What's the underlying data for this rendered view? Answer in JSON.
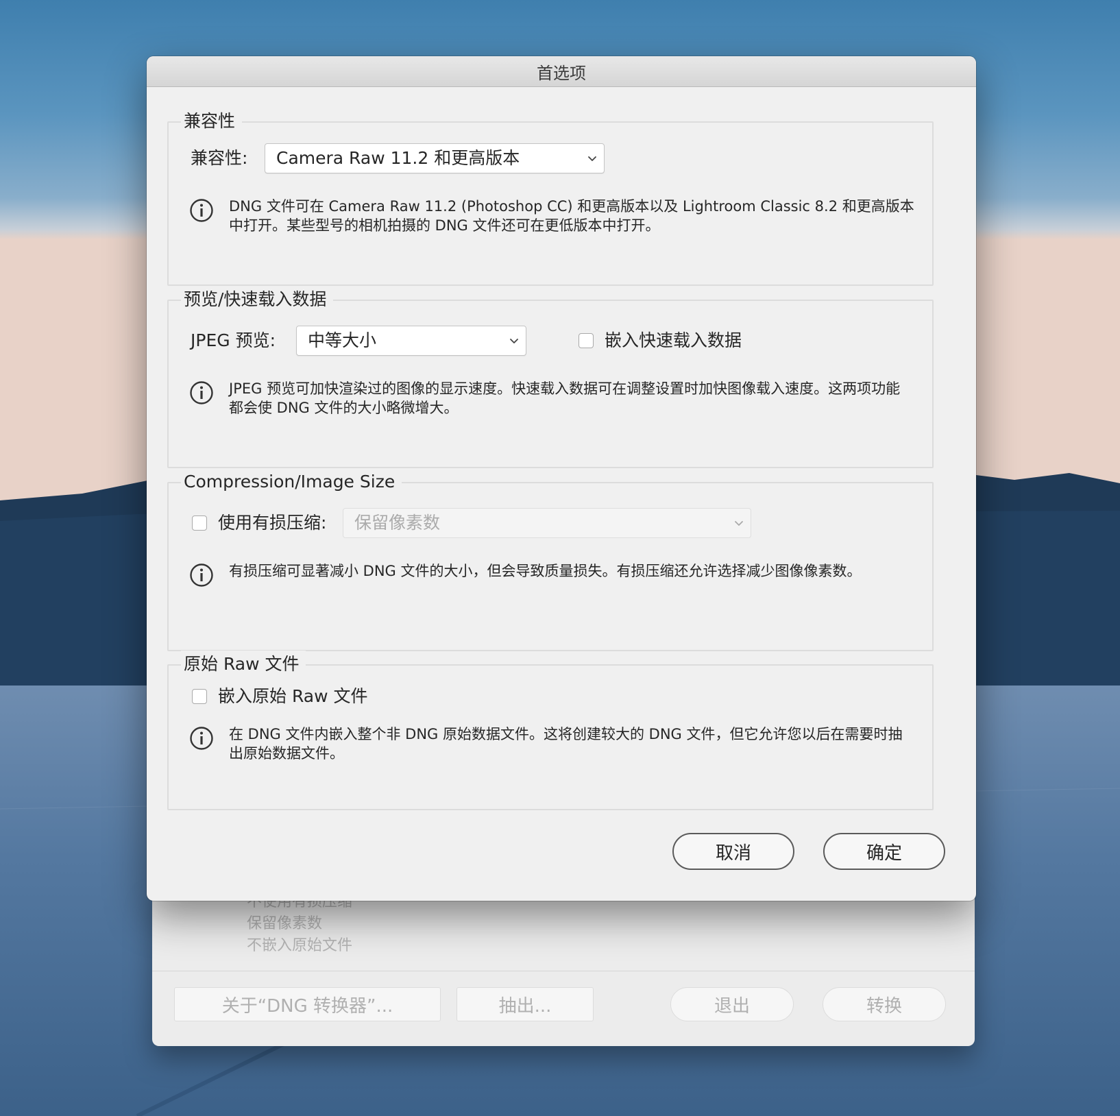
{
  "background_window": {
    "summary_lines": [
      "不使用有损压缩",
      "保留像素数",
      "不嵌入原始文件"
    ],
    "buttons": {
      "about": "关于“DNG 转换器”...",
      "extract": "抽出...",
      "quit": "退出",
      "convert": "转换"
    }
  },
  "dialog": {
    "title": "首选项",
    "compatibility": {
      "group_title": "兼容性",
      "label": "兼容性:",
      "selected": "Camera Raw 11.2 和更高版本",
      "info": "DNG 文件可在 Camera Raw 11.2 (Photoshop CC) 和更高版本以及 Lightroom Classic 8.2 和更高版本中打开。某些型号的相机拍摄的 DNG 文件还可在更低版本中打开。"
    },
    "preview": {
      "group_title": "预览/快速载入数据",
      "jpeg_label": "JPEG 预览:",
      "jpeg_selected": "中等大小",
      "fast_load_label": "嵌入快速载入数据",
      "fast_load_checked": false,
      "info": "JPEG 预览可加快渲染过的图像的显示速度。快速载入数据可在调整设置时加快图像载入速度。这两项功能都会使 DNG 文件的大小略微增大。"
    },
    "compression": {
      "group_title": "Compression/Image Size",
      "lossy_label": "使用有损压缩:",
      "lossy_checked": false,
      "size_selected": "保留像素数",
      "info": "有损压缩可显著减小 DNG 文件的大小，但会导致质量损失。有损压缩还允许选择减少图像像素数。"
    },
    "raw": {
      "group_title": "原始 Raw 文件",
      "embed_label": "嵌入原始 Raw 文件",
      "embed_checked": false,
      "info": "在 DNG 文件内嵌入整个非 DNG 原始数据文件。这将创建较大的 DNG 文件，但它允许您以后在需要时抽出原始数据文件。"
    },
    "buttons": {
      "cancel": "取消",
      "ok": "确定"
    }
  }
}
